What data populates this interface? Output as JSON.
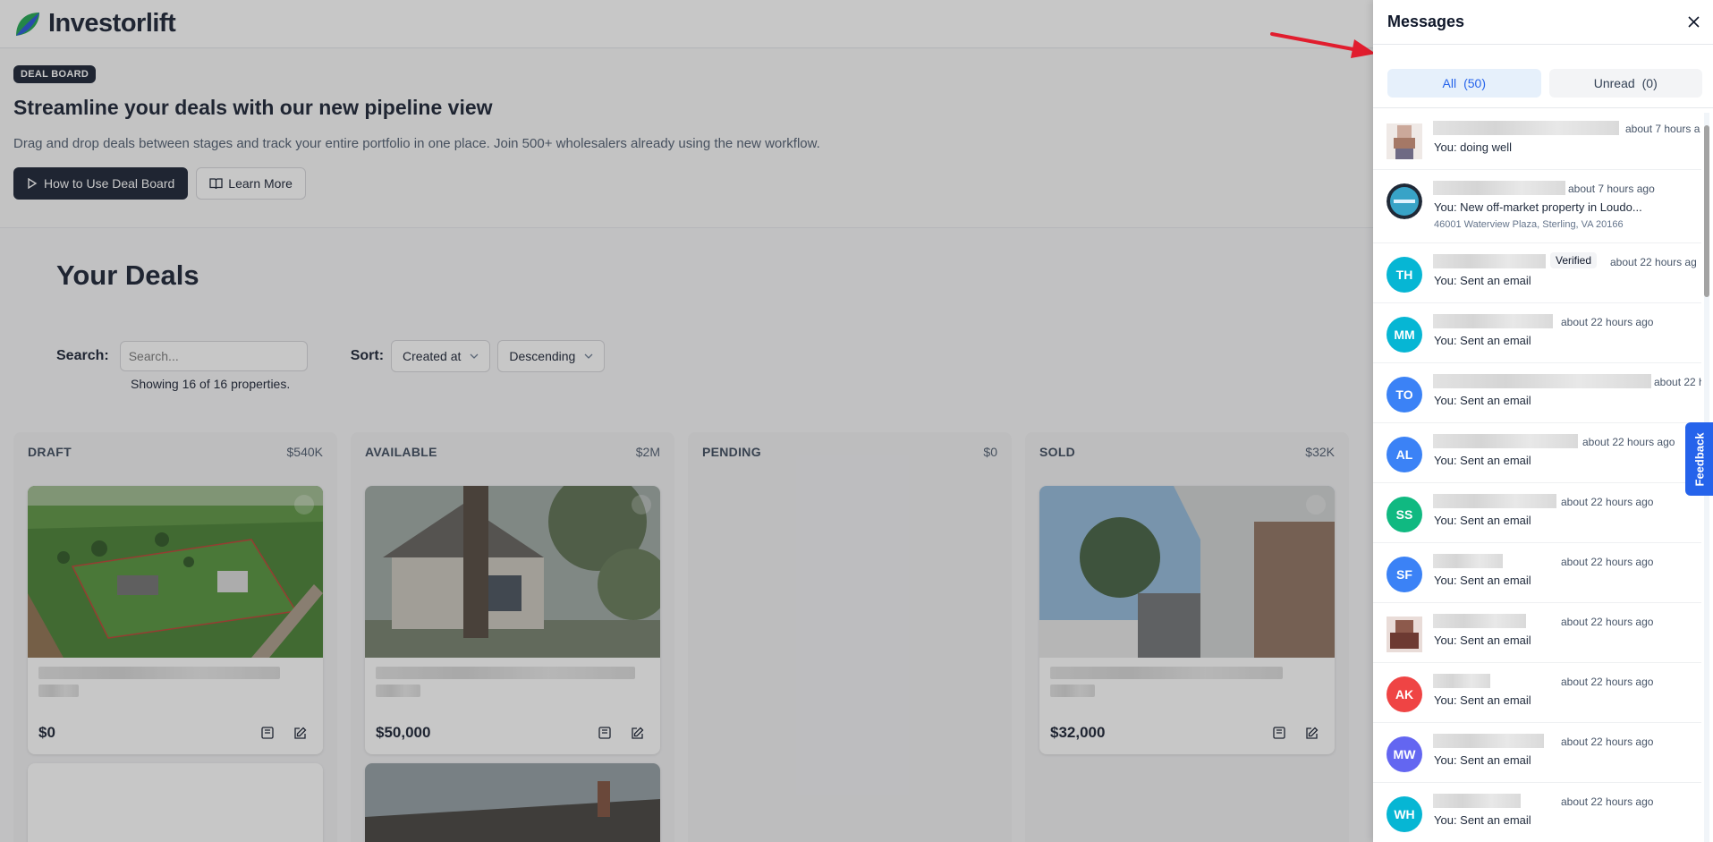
{
  "app": {
    "name": "Investorlift"
  },
  "banner": {
    "badge": "DEAL BOARD",
    "title": "Streamline your deals with our new pipeline view",
    "subtitle": "Drag and drop deals between stages and track your entire portfolio in one place. Join 500+ wholesalers already using the new workflow.",
    "primary_button": "How to Use Deal Board",
    "secondary_button": "Learn More"
  },
  "deals": {
    "title": "Your Deals",
    "search_label": "Search:",
    "search_placeholder": "Search...",
    "showing": "Showing 16 of 16 properties.",
    "sort_label": "Sort:",
    "sort_field": "Created at",
    "sort_order": "Descending"
  },
  "columns": [
    {
      "name": "DRAFT",
      "total": "$540K",
      "price": "$0"
    },
    {
      "name": "AVAILABLE",
      "total": "$2M",
      "price": "$50,000"
    },
    {
      "name": "PENDING",
      "total": "$0",
      "price": ""
    },
    {
      "name": "SOLD",
      "total": "$32K",
      "price": "$32,000"
    }
  ],
  "messages": {
    "title": "Messages",
    "tabs": [
      {
        "label": "All",
        "count": "(50)"
      },
      {
        "label": "Unread",
        "count": "(0)"
      }
    ],
    "verified_label": "Verified",
    "items": [
      {
        "initials": "",
        "time": "about 7 hours a",
        "preview": "You: doing well"
      },
      {
        "initials": "",
        "time": "about 7 hours ago",
        "preview": "You: New off-market property in Loudo...",
        "address": "46001 Waterview Plaza, Sterling, VA 20166"
      },
      {
        "initials": "TH",
        "time": "about 22 hours ag",
        "preview": "You: Sent an email"
      },
      {
        "initials": "MM",
        "time": "about 22 hours ago",
        "preview": "You: Sent an email"
      },
      {
        "initials": "TO",
        "time": "about 22 h",
        "preview": "You: Sent an email"
      },
      {
        "initials": "AL",
        "time": "about 22 hours ago",
        "preview": "You: Sent an email"
      },
      {
        "initials": "SS",
        "time": "about 22 hours ago",
        "preview": "You: Sent an email"
      },
      {
        "initials": "SF",
        "time": "about 22 hours ago",
        "preview": "You: Sent an email"
      },
      {
        "initials": "",
        "time": "about 22 hours ago",
        "preview": "You: Sent an email"
      },
      {
        "initials": "AK",
        "time": "about 22 hours ago",
        "preview": "You: Sent an email"
      },
      {
        "initials": "MW",
        "time": "about 22 hours ago",
        "preview": "You: Sent an email"
      },
      {
        "initials": "WH",
        "time": "about 22 hours ago",
        "preview": "You: Sent an email"
      }
    ]
  },
  "feedback_label": "Feedback",
  "colors": {
    "accent": "#2563eb",
    "dark": "#0f172a",
    "arrow": "#e11d2e",
    "avatar_cyan": "#06b6d4",
    "avatar_blue": "#3b82f6",
    "avatar_green": "#10b981",
    "avatar_red": "#ef4444",
    "avatar_indigo": "#6366f1"
  }
}
